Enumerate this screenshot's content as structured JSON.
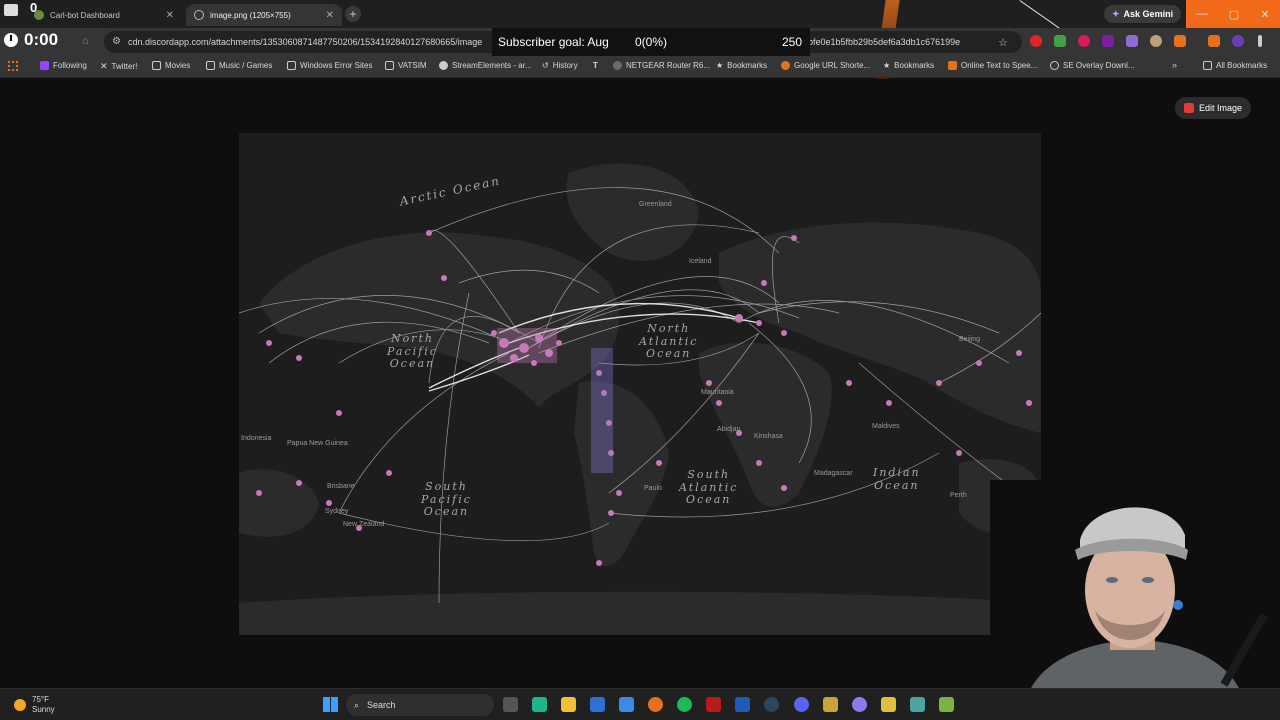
{
  "tabs": [
    {
      "title": "Carl-bot Dashboard",
      "active": false
    },
    {
      "title": "image.png (1205×755)",
      "active": true
    }
  ],
  "browser": {
    "url": "cdn.discordapp.com/attachments/1353060871487750206/1534192840127680665/image",
    "url_tail": "bfe0e1b5fbb29b5def6a3db1c676199e",
    "ask_gemini": "Ask Gemini",
    "edit_image": "Edit Image"
  },
  "bookmarks": [
    {
      "label": "Following",
      "icon": "twitch-icon"
    },
    {
      "label": "Twitter!",
      "icon": "x-icon"
    },
    {
      "label": "Movies",
      "icon": "folder-icon"
    },
    {
      "label": "Music / Games",
      "icon": "folder-icon"
    },
    {
      "label": "Windows Error Sites",
      "icon": "folder-icon"
    },
    {
      "label": "VATSIM",
      "icon": "folder-icon"
    },
    {
      "label": "StreamElements - ar...",
      "icon": "streamelements-icon"
    },
    {
      "label": "History",
      "icon": "history-icon"
    },
    {
      "label": "",
      "icon": "tm-icon"
    },
    {
      "label": "NETGEAR Router R6...",
      "icon": "netgear-icon"
    },
    {
      "label": "Bookmarks",
      "icon": "star-icon"
    },
    {
      "label": "Google URL Shorte...",
      "icon": "google-icon"
    },
    {
      "label": "Bookmarks",
      "icon": "star-icon"
    },
    {
      "label": "Online Text to Spee...",
      "icon": "tts-icon"
    },
    {
      "label": "SE Overlay Downl...",
      "icon": "globe-icon"
    },
    {
      "label": "All Bookmarks",
      "icon": "folder-icon"
    }
  ],
  "overlay": {
    "notification_count": "0",
    "timer": "0:00",
    "subscriber_goal_label": "Subscriber goal: Aug",
    "subscriber_goal_progress": "0(0%)",
    "subscriber_goal_target": "250"
  },
  "map": {
    "oceans": {
      "arctic": "Arctic Ocean",
      "north_pacific": "North\nPacific\nOcean",
      "north_atlantic": "North\nAtlantic\nOcean",
      "south_pacific": "South\nPacific\nOcean",
      "south_atlantic": "South\nAtlantic\nOcean",
      "indian": "Indian\nOcean"
    },
    "cities": [
      "Beijing",
      "Abidjan",
      "Kinshasa",
      "Madagascar",
      "Maldives",
      "Perth",
      "Brisbane",
      "Sydney",
      "New Zealand",
      "Papua New Guinea",
      "Indonesia",
      "Mauritania",
      "Paulo",
      "Iceland",
      "Greenland"
    ]
  },
  "taskbar": {
    "weather_temp": "75°F",
    "weather_desc": "Sunny",
    "search": "Search"
  },
  "colors": {
    "route_node": "#c77ab8",
    "route_line": "#ffffff",
    "land": "#2b2b2b",
    "ocean": "#1d1d1d",
    "accent_browser": "#e8701a"
  }
}
